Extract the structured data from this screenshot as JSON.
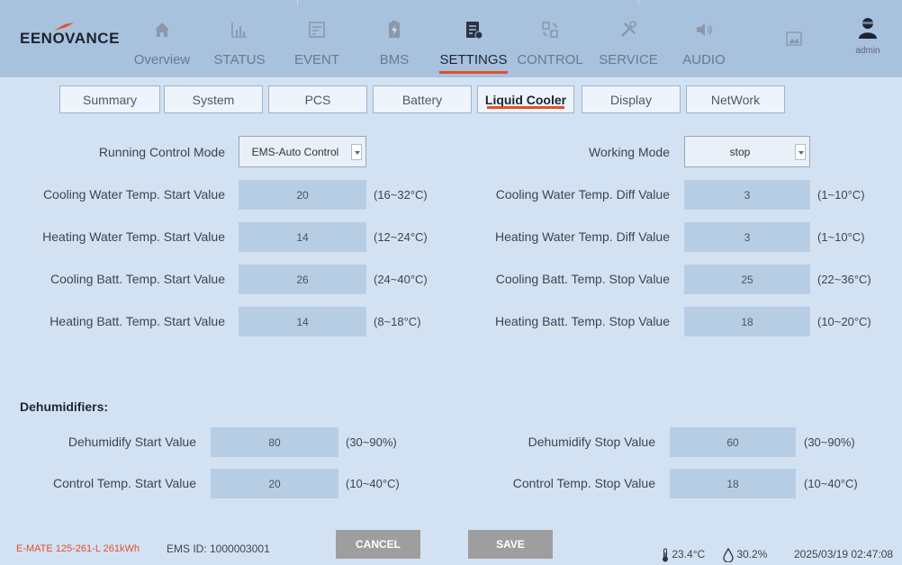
{
  "brand": {
    "name": "EENOVANCE"
  },
  "nav": {
    "items": [
      {
        "label": "Overview",
        "icon": "home-icon"
      },
      {
        "label": "STATUS",
        "icon": "chart-icon"
      },
      {
        "label": "EVENT",
        "icon": "event-icon"
      },
      {
        "label": "BMS",
        "icon": "battery-icon"
      },
      {
        "label": "SETTINGS",
        "icon": "settings-icon",
        "active": true
      },
      {
        "label": "CONTROL",
        "icon": "control-icon"
      },
      {
        "label": "SERVICE",
        "icon": "tools-icon"
      },
      {
        "label": "AUDIO",
        "icon": "speaker-icon"
      },
      {
        "label": "",
        "icon": "image-icon"
      }
    ],
    "user": "admin",
    "accent": "#e2502a"
  },
  "tabs": [
    "Summary",
    "System",
    "PCS",
    "Battery",
    "Liquid Cooler",
    "Display",
    "NetWork"
  ],
  "active_tab": "Liquid Cooler",
  "left": {
    "running_mode_label": "Running Control Mode",
    "running_mode_value": "EMS-Auto Control",
    "rows": [
      {
        "label": "Cooling Water Temp. Start Value",
        "value": "20",
        "range": "(16~32°C)"
      },
      {
        "label": "Heating Water Temp. Start Value",
        "value": "14",
        "range": "(12~24°C)"
      },
      {
        "label": "Cooling Batt. Temp. Start Value",
        "value": "26",
        "range": "(24~40°C)"
      },
      {
        "label": "Heating Batt. Temp. Start Value",
        "value": "14",
        "range": "(8~18°C)"
      }
    ]
  },
  "right": {
    "working_mode_label": "Working Mode",
    "working_mode_value": "stop",
    "rows": [
      {
        "label": "Cooling Water Temp. Diff Value",
        "value": "3",
        "range": "(1~10°C)"
      },
      {
        "label": "Heating Water Temp. Diff Value",
        "value": "3",
        "range": "(1~10°C)"
      },
      {
        "label": "Cooling Batt. Temp. Stop Value",
        "value": "25",
        "range": "(22~36°C)"
      },
      {
        "label": "Heating Batt. Temp. Stop Value",
        "value": "18",
        "range": "(10~20°C)"
      }
    ]
  },
  "dehumidifiers": {
    "title": "Dehumidifiers:",
    "left": [
      {
        "label": "Dehumidify Start Value",
        "value": "80",
        "range": "(30~90%)"
      },
      {
        "label": "Control Temp. Start Value",
        "value": "20",
        "range": "(10~40°C)"
      }
    ],
    "right": [
      {
        "label": "Dehumidify Stop Value",
        "value": "60",
        "range": "(30~90%)"
      },
      {
        "label": "Control Temp. Stop Value",
        "value": "18",
        "range": "(10~40°C)"
      }
    ]
  },
  "footer": {
    "model": "E-MATE 125-261-L 261kWh",
    "ems_id": "EMS ID: 1000003001",
    "cancel": "CANCEL",
    "save": "SAVE",
    "temperature": "23.4°C",
    "humidity": "30.2%",
    "datetime": "2025/03/19 02:47:08"
  }
}
